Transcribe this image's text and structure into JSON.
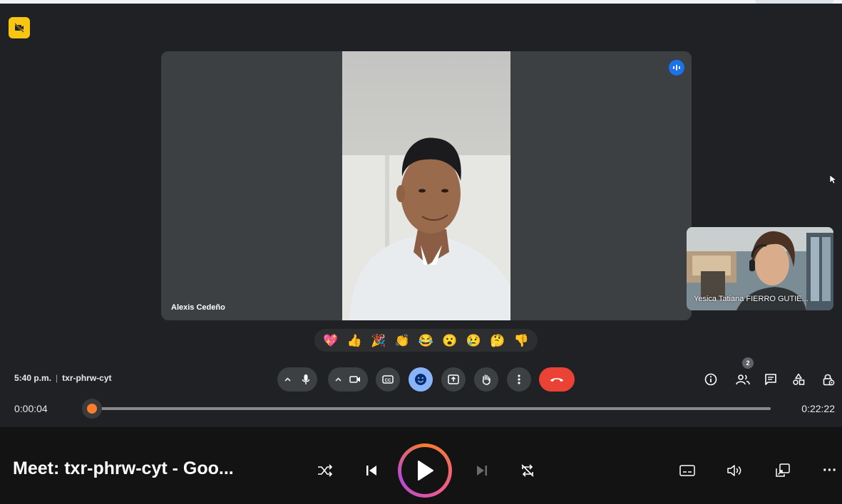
{
  "meeting": {
    "main_participant": "Alexis Cedeño",
    "self_participant": "Yesica Tatiana FIERRO GUTIE...",
    "time": "5:40 p.m.",
    "separator": "|",
    "code": "txr-phrw-cyt",
    "people_count": "2",
    "reactions": [
      "💖",
      "👍",
      "🎉",
      "👏",
      "😂",
      "😮",
      "😢",
      "🤔",
      "👎"
    ]
  },
  "controls": {
    "icons": [
      "mic-icon",
      "camera-icon",
      "captions-icon",
      "emoji-icon",
      "present-icon",
      "raise-hand-icon",
      "more-options-icon",
      "end-call-icon"
    ],
    "right_icons": [
      "info-icon",
      "people-icon",
      "chat-icon",
      "activities-icon",
      "host-controls-icon"
    ]
  },
  "player": {
    "current_time": "0:00:04",
    "total_time": "0:22:22",
    "progress": 0.003,
    "title": "Meet: txr-phrw-cyt - Goo...",
    "more_label": "···",
    "accent": "#f97d2c"
  }
}
